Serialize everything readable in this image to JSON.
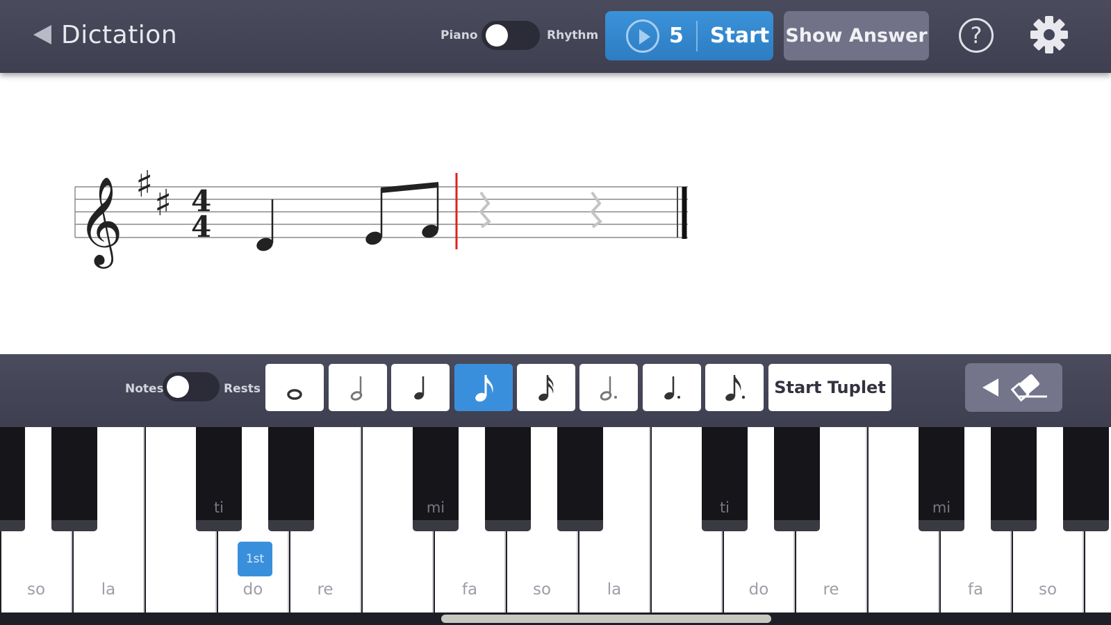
{
  "header": {
    "back_label": "Dictation",
    "mode_left": "Piano",
    "mode_right": "Rhythm",
    "play_count": "5",
    "start_label": "Start",
    "show_answer_label": "Show Answer",
    "help_symbol": "?"
  },
  "toolbar": {
    "notes_label": "Notes",
    "rests_label": "Rests",
    "durations": [
      {
        "name": "whole-note-icon",
        "selected": false
      },
      {
        "name": "half-note-icon",
        "selected": false
      },
      {
        "name": "quarter-note-icon",
        "selected": false
      },
      {
        "name": "eighth-note-icon",
        "selected": true
      },
      {
        "name": "sixteenth-note-icon",
        "selected": false
      },
      {
        "name": "dotted-half-note-icon",
        "selected": false
      },
      {
        "name": "dotted-quarter-note-icon",
        "selected": false
      },
      {
        "name": "dotted-eighth-note-icon",
        "selected": false
      }
    ],
    "tuplet_label": "Start Tuplet"
  },
  "staff": {
    "clef": "treble",
    "key_signature_sharps": 2,
    "time_signature": {
      "top": "4",
      "bottom": "4"
    }
  },
  "keyboard": {
    "white_keys": [
      "so",
      "la",
      "",
      "do",
      "re",
      "",
      "fa",
      "so",
      "la",
      "",
      "do",
      "re",
      "",
      "fa",
      "so",
      ""
    ],
    "black_keys": [
      "",
      "",
      "ti",
      "",
      "mi",
      "",
      "",
      "ti",
      "",
      "mi",
      "",
      ""
    ],
    "first_badge": "1st"
  },
  "colors": {
    "accent": "#3a8fdc",
    "playhead": "#e02020",
    "bar": "#44455a"
  }
}
